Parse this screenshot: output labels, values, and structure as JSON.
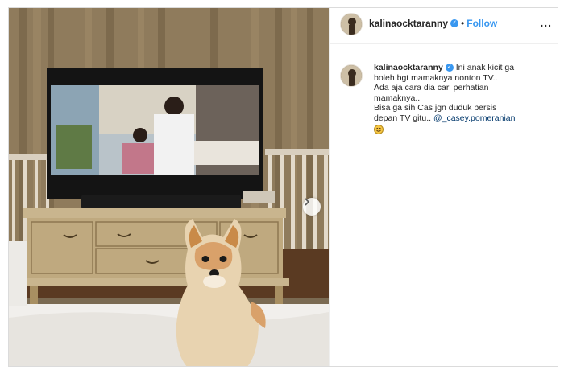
{
  "post": {
    "username": "kalinaocktaranny",
    "follow_label": "Follow",
    "separator": "•",
    "more_label": "...",
    "caption_lines": [
      "Ini anak kicit ga",
      "boleh bgt mamaknya nonton TV..",
      "Ada aja cara dia cari perhatian",
      "mamaknya..",
      "Bisa ga sih Cas jgn duduk persis",
      "depan TV gitu.."
    ],
    "mention": "@_casey.pomeranian",
    "verified_glyph": "✓"
  },
  "colors": {
    "accent": "#3897f0",
    "text": "#262626",
    "mention": "#00376b"
  },
  "icons": {
    "verified": "verified-badge-icon",
    "next": "chevron-right-icon",
    "emoji": "grinning-emoji-icon"
  }
}
